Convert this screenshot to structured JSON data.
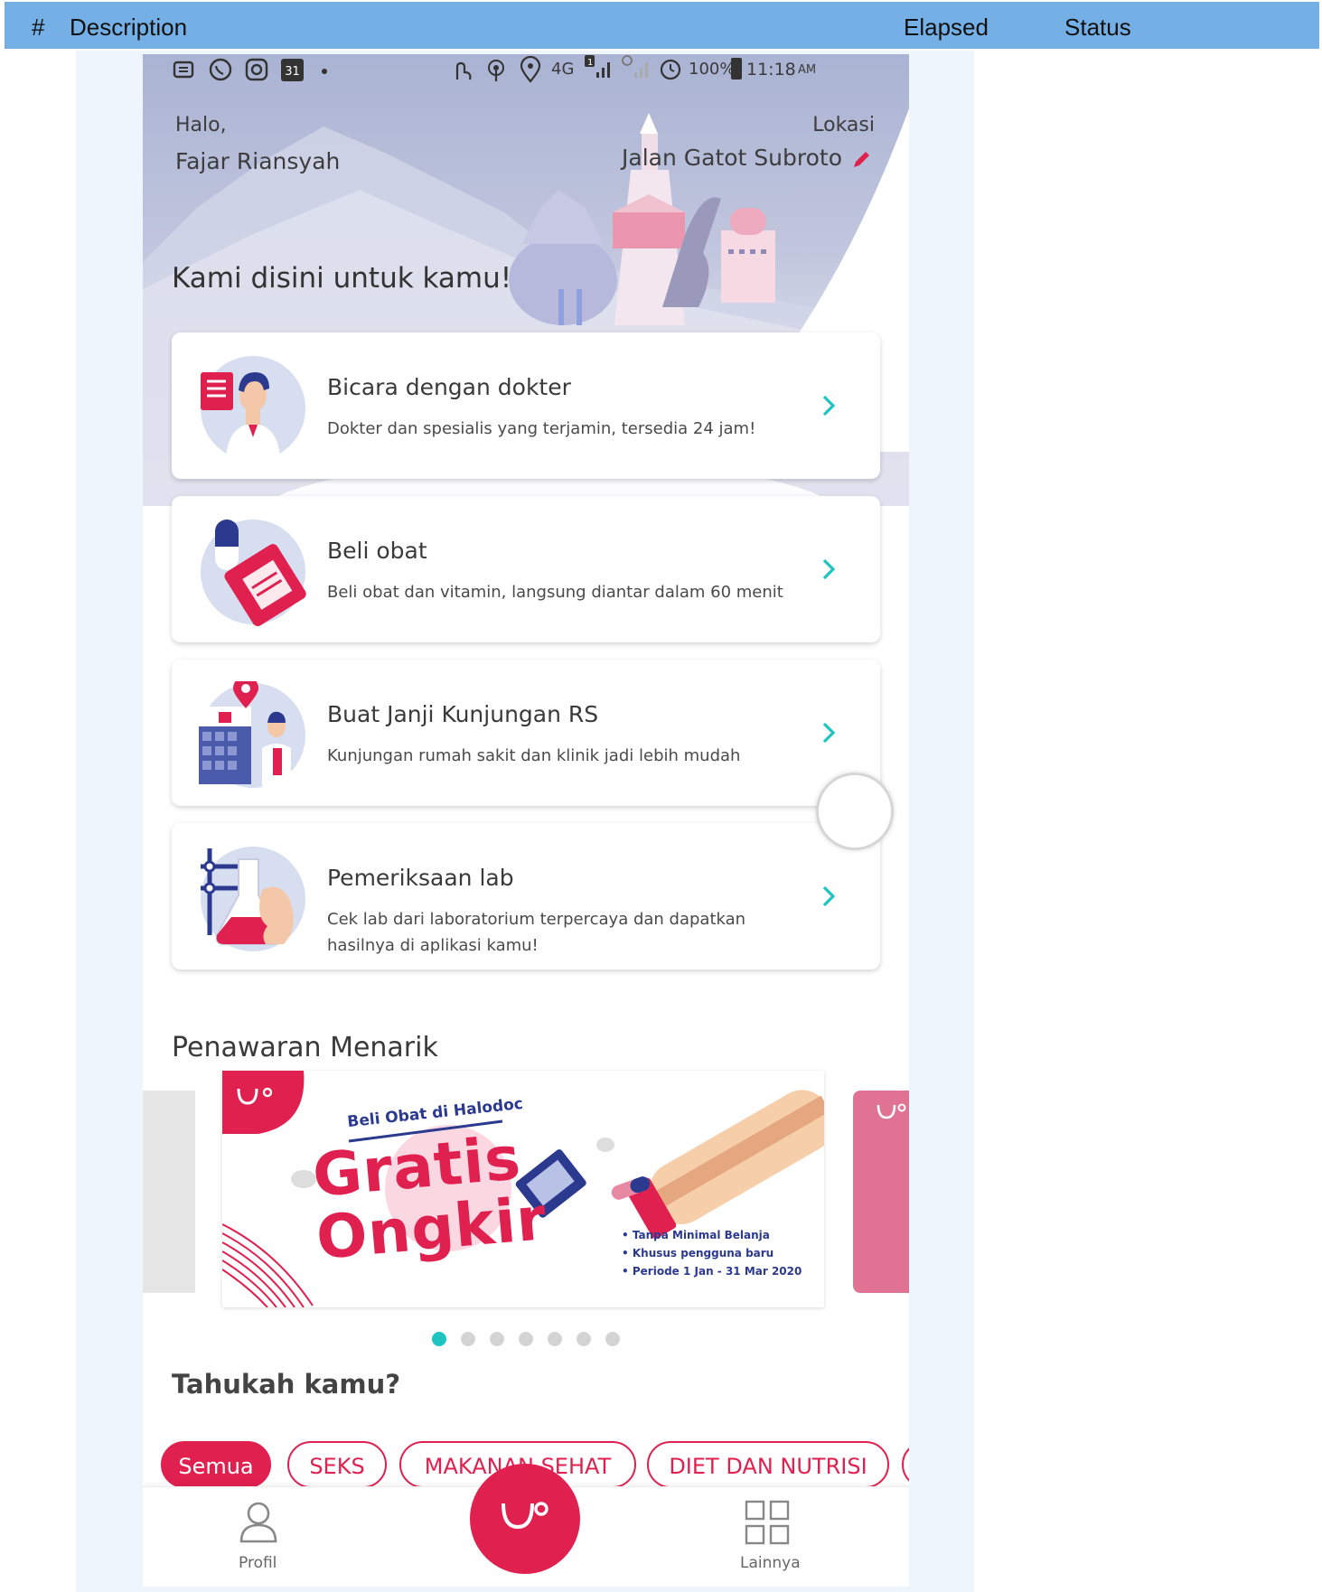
{
  "table_header": {
    "num": "#",
    "description": "Description",
    "elapsed": "Elapsed",
    "status": "Status"
  },
  "status_bar": {
    "calendar_day": "31",
    "network": "4G",
    "sim_badge": "1",
    "battery": "100%",
    "time": "11:18",
    "ampm": "AM"
  },
  "header": {
    "greeting": "Halo,",
    "user_name": "Fajar Riansyah",
    "location_label": "Lokasi",
    "location_value": "Jalan Gatot Subroto"
  },
  "tagline": "Kami disini untuk kamu!",
  "services": [
    {
      "title": "Bicara dengan dokter",
      "subtitle": "Dokter dan spesialis yang terjamin, tersedia 24 jam!",
      "icon": "doctor-icon"
    },
    {
      "title": "Beli obat",
      "subtitle": "Beli obat dan vitamin, langsung diantar dalam 60 menit",
      "icon": "medicine-icon"
    },
    {
      "title": "Buat Janji Kunjungan RS",
      "subtitle": "Kunjungan rumah sakit dan klinik jadi lebih mudah",
      "icon": "hospital-icon"
    },
    {
      "title": "Pemeriksaan lab",
      "subtitle": "Cek lab dari laboratorium terpercaya dan dapatkan hasilnya di aplikasi kamu!",
      "icon": "lab-flask-icon"
    }
  ],
  "promo": {
    "section_title": "Penawaran Menarik",
    "banner": {
      "headline_small": "Beli Obat di Halodoc",
      "headline_big_1": "Gratis",
      "headline_big_2": "Ongkir",
      "bullets": [
        "Tanpa Minimal Belanja",
        "Khusus pengguna baru",
        "Periode 1 Jan - 31 Mar 2020"
      ]
    },
    "dots_total": 7,
    "dots_active": 1
  },
  "articles": {
    "section_title": "Tahukah kamu?",
    "chips": [
      {
        "label": "Semua",
        "active": true
      },
      {
        "label": "SEKS",
        "active": false
      },
      {
        "label": "MAKANAN SEHAT",
        "active": false
      },
      {
        "label": "DIET DAN NUTRISI",
        "active": false
      }
    ]
  },
  "bottom_nav": {
    "profile_label": "Profil",
    "more_label": "Lainnya"
  },
  "colors": {
    "brand": "#e0204f",
    "accent": "#1fc4c0",
    "header_bar": "#74afe6",
    "navy": "#2b3a8f"
  }
}
